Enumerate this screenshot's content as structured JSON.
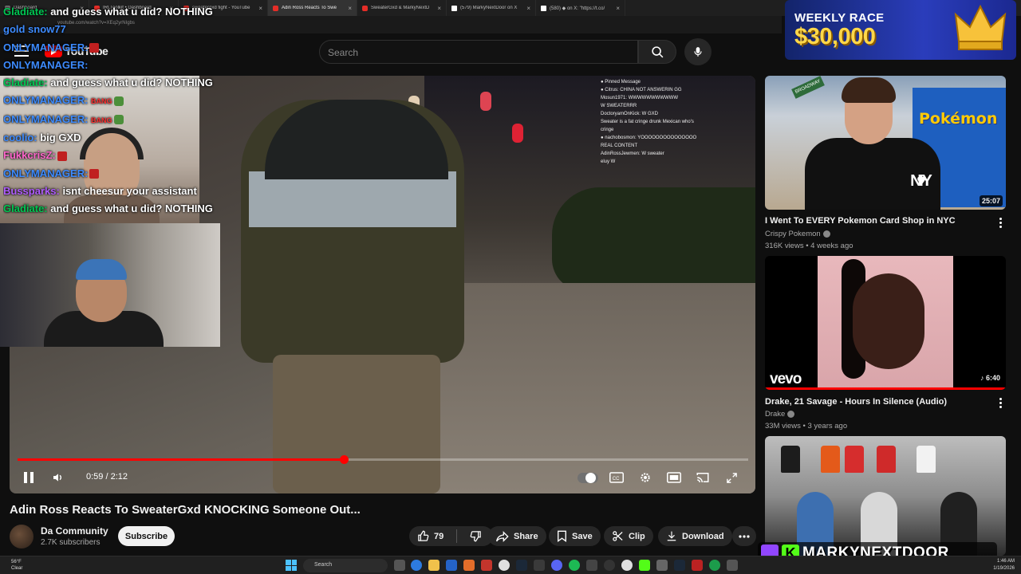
{
  "browser": {
    "tabs": [
      {
        "label": "Dashboard",
        "favicon": "dashboard-icon",
        "active": false
      },
      {
        "label": "IRLToolkit • Dashboard",
        "favicon": "youtube-icon",
        "active": false
      },
      {
        "label": "sweatergxd fight - YouTube",
        "favicon": "youtube-icon",
        "active": false
      },
      {
        "label": "Adin Ross Reacts To Swe",
        "favicon": "youtube-icon",
        "active": true
      },
      {
        "label": "SweaterGxd & MarkyNextD",
        "favicon": "youtube-icon",
        "active": false
      },
      {
        "label": "(579) MarkyNextDoor on X",
        "favicon": "x-icon",
        "active": false
      },
      {
        "label": "(580) ◆ on X: \"https://t.co/",
        "favicon": "x-icon",
        "active": false
      }
    ],
    "address": "youtube.com/watch?v=XEq2yrNIgbs"
  },
  "masthead": {
    "logo_text": "YouTube",
    "search_placeholder": "Search"
  },
  "chat": [
    {
      "user": "Gladiate:",
      "message": "and guess what u did? NOTHING",
      "color": "#00c853",
      "badges": 0,
      "emote": false
    },
    {
      "user": "gold snow77",
      "message": "",
      "color": "#3d8bff",
      "badges": 0,
      "emote": false
    },
    {
      "user": "ONLYMANAGER:",
      "message": "",
      "color": "#3d8bff",
      "badges": 1,
      "emote": false
    },
    {
      "user": "ONLYMANAGER:",
      "message": "",
      "color": "#3d8bff",
      "badges": 0,
      "emote": false
    },
    {
      "user": "Gladiate:",
      "message": "and guess what u did? NOTHING",
      "color": "#00c853",
      "badges": 0,
      "emote": false
    },
    {
      "user": "ONLYMANAGER:",
      "message": "BANG",
      "color": "#3d8bff",
      "badges": 0,
      "emote": true
    },
    {
      "user": "ONLYMANAGER:",
      "message": "BANG",
      "color": "#3d8bff",
      "badges": 0,
      "emote": true
    },
    {
      "user": "coolio:",
      "message": "big GXD",
      "color": "#3d8bff",
      "badges": 0,
      "emote": false
    },
    {
      "user": "FukkcrisZ:",
      "message": "",
      "color": "#ff66cc",
      "badges": 1,
      "emote": false
    },
    {
      "user": "ONLYMANAGER:",
      "message": "",
      "color": "#3d8bff",
      "badges": 1,
      "emote": false
    },
    {
      "user": "Bussparks:",
      "message": "isnt cheesur your assistant",
      "color": "#b05cff",
      "badges": 0,
      "emote": false
    },
    {
      "user": "Gladiate:",
      "message": "and guess what u did? NOTHING",
      "color": "#00c853",
      "badges": 0,
      "emote": false
    }
  ],
  "pinned_chat": [
    "● Pinned Message",
    "● Citrus: CHINA NOT ANSWERIN GG",
    "Mosun1971: WWWWWWWWWWW",
    "W SWEATERRR",
    "DoctoryamOnKick: W GXD",
    "Sweater is a fat cringe drunk Mexican who's",
    "cringe",
    "● nachobosmon: YOOOOOOOOOOOOOOO",
    "REAL CONTENT",
    "AdinRossJewmen: W sweater",
    "eluy W"
  ],
  "player": {
    "current_time": "0:59",
    "duration": "2:12",
    "time_display": "0:59 / 2:12",
    "progress_fraction": 0.447,
    "progress_color": "#ff0000"
  },
  "video": {
    "title": "Adin Ross Reacts To SweaterGxd KNOCKING Someone Out...",
    "channel": "Da Community",
    "subscribers": "2.7K subscribers",
    "subscribe_label": "Subscribe",
    "likes": "79",
    "share_label": "Share",
    "save_label": "Save",
    "clip_label": "Clip",
    "download_label": "Download"
  },
  "recommendations": [
    {
      "title": "I Went To EVERY Pokemon Card Shop in NYC",
      "channel": "Crispy Pokemon",
      "meta": "316K views • 4 weeks ago",
      "duration": "25:07",
      "thumb_text": "Pokémon",
      "shirt_text_top": "I",
      "shirt_text_heart": "♥",
      "shirt_text_bottom": "NY",
      "sign_text": "BROADWAY"
    },
    {
      "title": "Drake, 21 Savage - Hours In Silence (Audio)",
      "channel": "Drake",
      "meta": "33M views • 3 years ago",
      "duration": "♪ 6:40",
      "thumb_text": "vevo"
    },
    {
      "title": "",
      "channel": "",
      "meta": "",
      "duration": ""
    }
  ],
  "ad": {
    "race_label": "WEEKLY RACE",
    "race_amount": "$30,000",
    "gold": "#ffd84a"
  },
  "stream_overlay": {
    "kick_letter": "K",
    "name": "MARKYNEXTDOOR",
    "kick_color": "#53fc18",
    "twitch_color": "#9146ff"
  },
  "taskbar": {
    "weather_temp": "56°F",
    "weather_cond": "Clear",
    "search_label": "Search",
    "time": "1:46 AM",
    "date": "1/19/2026"
  }
}
